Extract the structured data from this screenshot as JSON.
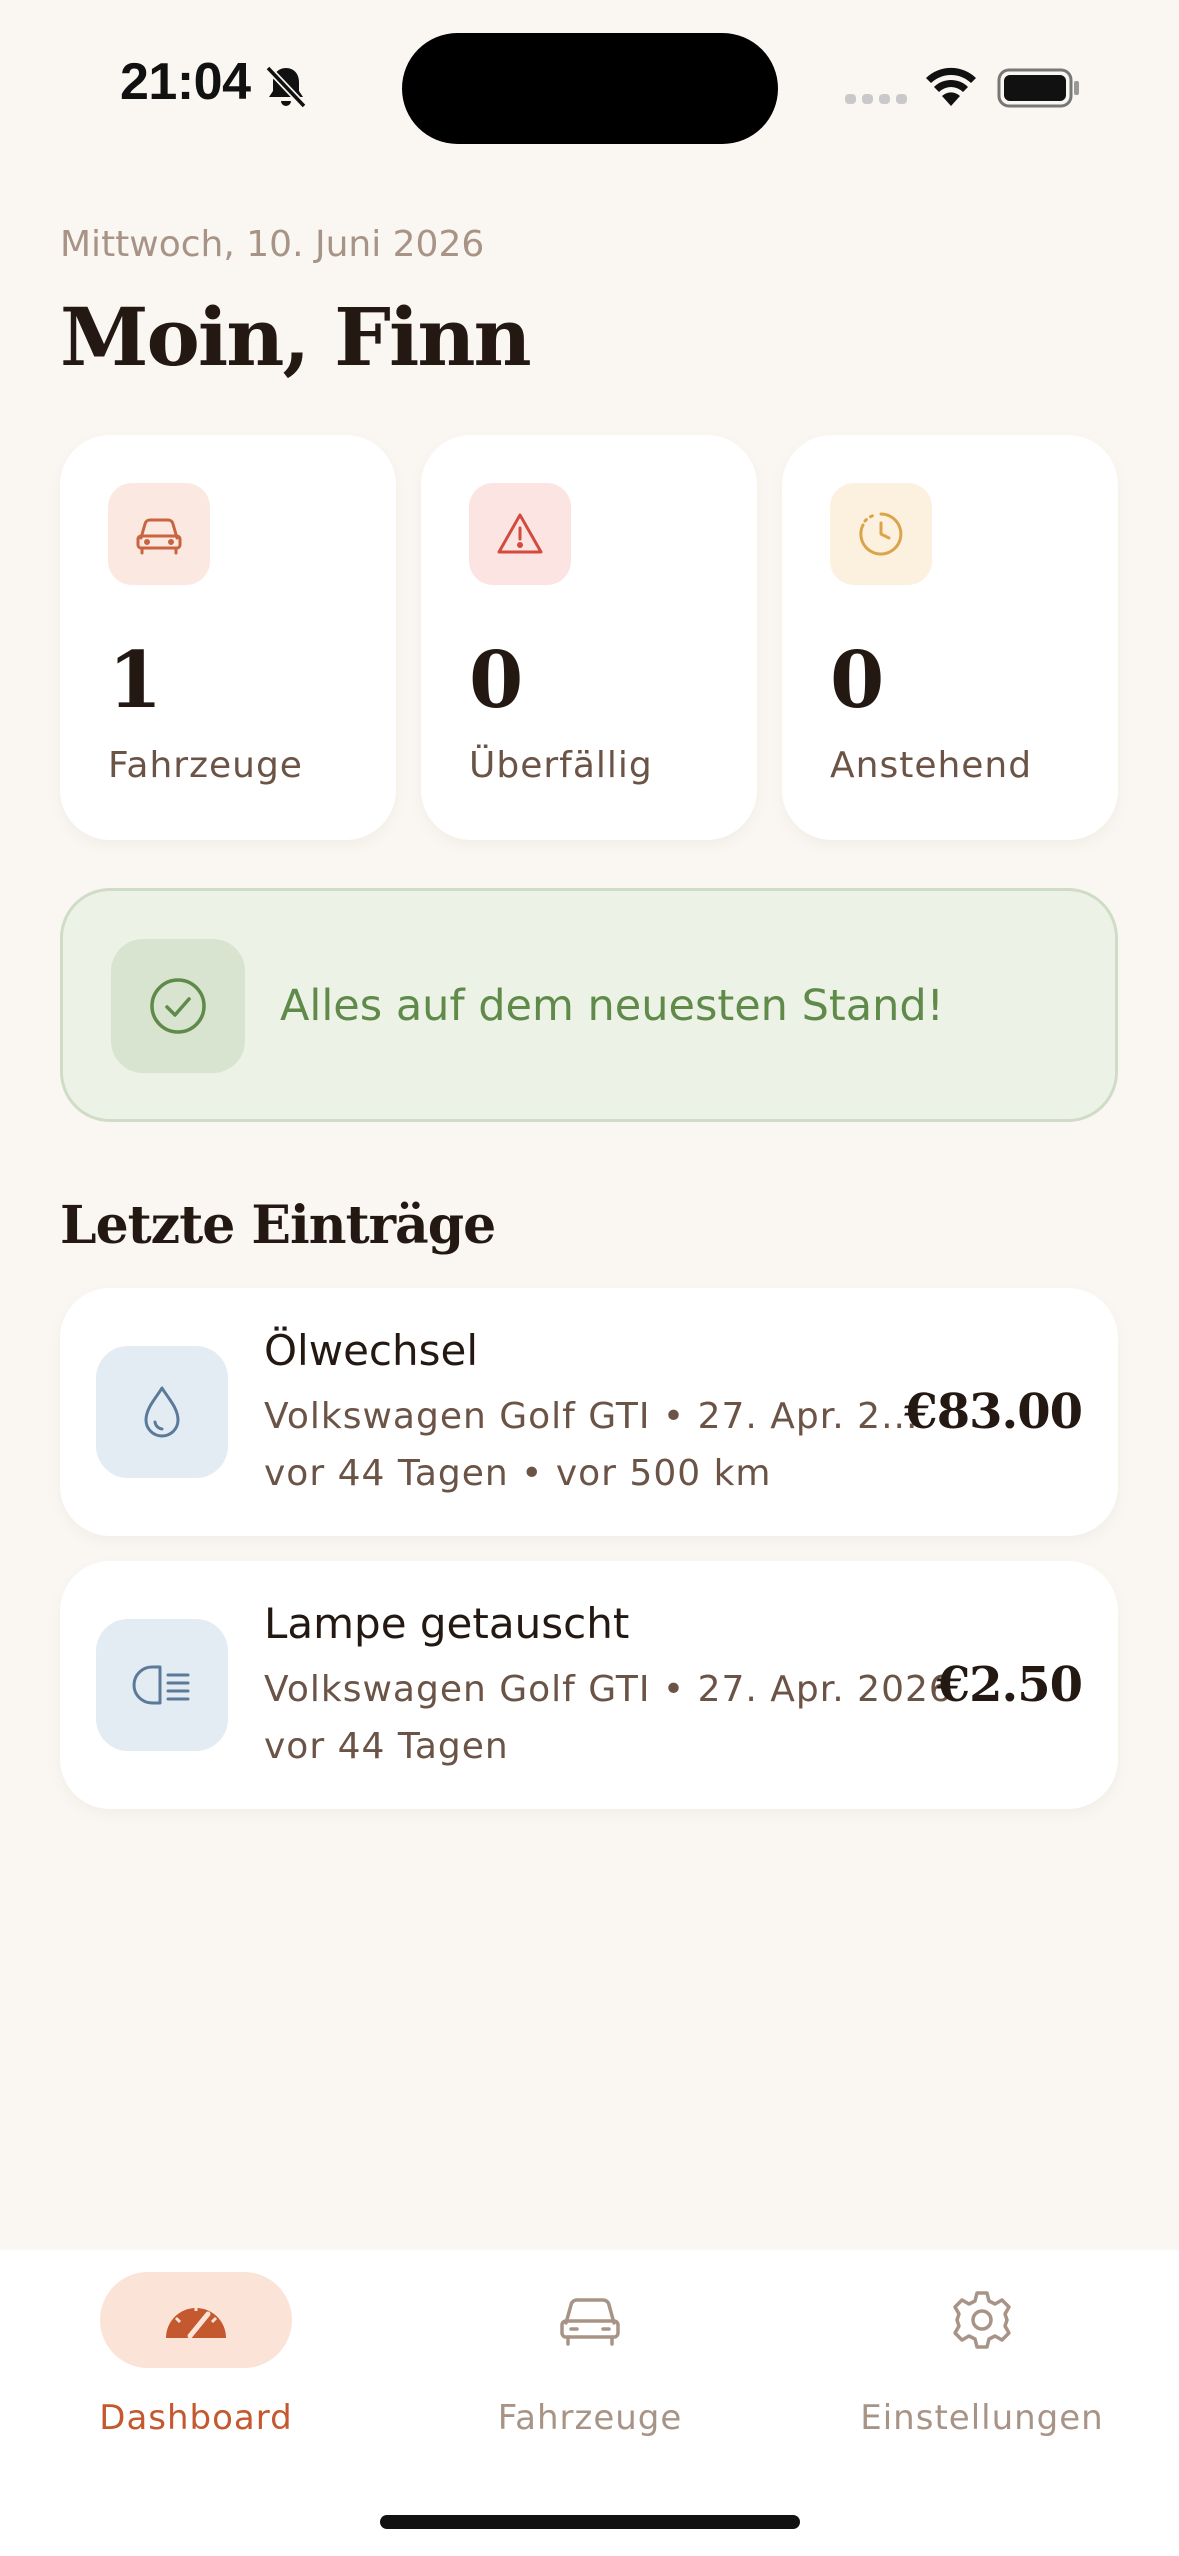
{
  "status_bar": {
    "time": "21:04",
    "icons": [
      "bell-slash-icon",
      "signal-icon",
      "wifi-icon",
      "battery-icon"
    ]
  },
  "header": {
    "date": "Mittwoch, 10. Juni 2026",
    "greeting": "Moin, Finn"
  },
  "stats": [
    {
      "icon": "car-icon",
      "value": "1",
      "label": "Fahrzeuge",
      "accent": "#c8643f",
      "bg": "#fbe9e1"
    },
    {
      "icon": "warning-icon",
      "value": "0",
      "label": "Überfällig",
      "accent": "#d24b3e",
      "bg": "#fbe4e1"
    },
    {
      "icon": "clock-icon",
      "value": "0",
      "label": "Anstehend",
      "accent": "#dba44a",
      "bg": "#fcf1de"
    }
  ],
  "banner": {
    "icon": "check-circle-icon",
    "text": "Alles auf dem neuesten Stand!"
  },
  "recent": {
    "title": "Letzte Einträge",
    "entries": [
      {
        "icon": "oil-drop-icon",
        "title": "Ölwechsel",
        "subtitle": "Volkswagen Golf GTI • 27. Apr. 2...",
        "age": "vor 44 Tagen • vor 500 km",
        "price": "€83.00"
      },
      {
        "icon": "headlight-icon",
        "title": "Lampe getauscht",
        "subtitle": "Volkswagen Golf GTI • 27. Apr. 2026",
        "age": "vor 44 Tagen",
        "price": "€2.50"
      }
    ]
  },
  "tabbar": {
    "tabs": [
      {
        "label": "Dashboard",
        "icon": "speedometer-icon",
        "active": true
      },
      {
        "label": "Fahrzeuge",
        "icon": "car-icon",
        "active": false
      },
      {
        "label": "Einstellungen",
        "icon": "gear-icon",
        "active": false
      }
    ],
    "active_color": "#c4582f",
    "inactive_color": "#a89486"
  }
}
